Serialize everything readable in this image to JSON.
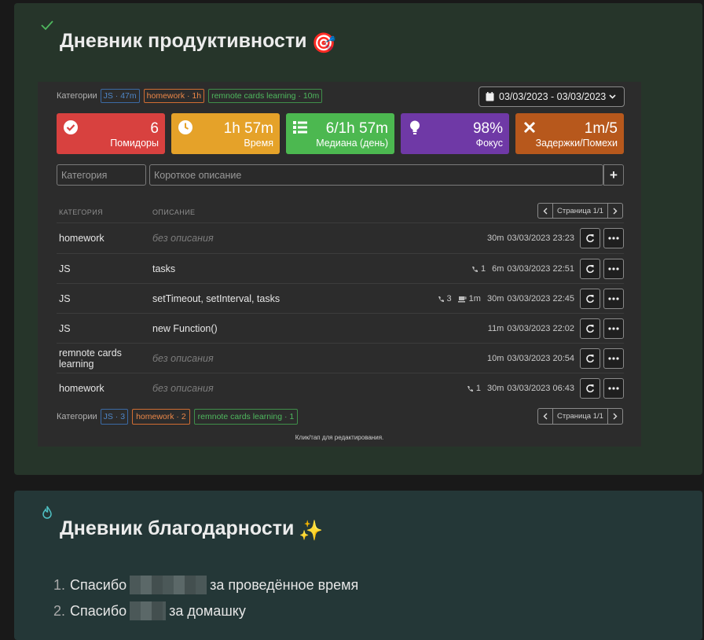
{
  "productivity": {
    "title": "Дневник продуктивности",
    "title_emoji": "🎯",
    "categories_label": "Категории",
    "top_chips": [
      {
        "text": "JS · 47m",
        "color": "blue"
      },
      {
        "text": "homework · 1h",
        "color": "orange"
      },
      {
        "text": "remnote cards learning · 10m",
        "color": "green"
      }
    ],
    "date_range": "03/03/2023 - 03/03/2023",
    "tiles": [
      {
        "value": "6",
        "caption": "Помидоры",
        "icon": "check-circle-icon",
        "color": "#d8413f"
      },
      {
        "value": "1h 57m",
        "caption": "Время",
        "icon": "clock-icon",
        "color": "#e5a229"
      },
      {
        "value": "6/1h 57m",
        "caption": "Медиана (день)",
        "icon": "list-icon",
        "color": "#4cb850"
      },
      {
        "value": "98%",
        "caption": "Фокус",
        "icon": "lightbulb-icon",
        "color": "#6f39a6"
      },
      {
        "value": "1m/5",
        "caption": "Задержки/Помехи",
        "icon": "times-icon",
        "color": "#b7581c"
      }
    ],
    "category_placeholder": "Категория",
    "description_placeholder": "Короткое описание",
    "add_label": "+",
    "col_category": "КАТЕГОРИЯ",
    "col_description": "ОПИСАНИЕ",
    "page_label": "Страница 1/1",
    "rows": [
      {
        "category": "homework",
        "description": "без описания",
        "empty": true,
        "calls": "",
        "breaks": "",
        "duration": "30m",
        "time": "03/03/2023 23:23"
      },
      {
        "category": "JS",
        "description": "tasks",
        "empty": false,
        "calls": "1",
        "breaks": "",
        "duration": "6m",
        "time": "03/03/2023 22:51"
      },
      {
        "category": "JS",
        "description": "setTimeout, setInterval, tasks",
        "empty": false,
        "calls": "3",
        "breaks": "1m",
        "duration": "30m",
        "time": "03/03/2023 22:45"
      },
      {
        "category": "JS",
        "description": "new Function()",
        "empty": false,
        "calls": "",
        "breaks": "",
        "duration": "11m",
        "time": "03/03/2023 22:02"
      },
      {
        "category": "remnote cards learning",
        "description": "без описания",
        "empty": true,
        "calls": "",
        "breaks": "",
        "duration": "10m",
        "time": "03/03/2023 20:54"
      },
      {
        "category": "homework",
        "description": "без описания",
        "empty": true,
        "calls": "1",
        "breaks": "",
        "duration": "30m",
        "time": "03/03/2023 06:43"
      }
    ],
    "bottom_chips": [
      {
        "text": "JS · 3",
        "color": "blue"
      },
      {
        "text": "homework · 2",
        "color": "orange"
      },
      {
        "text": "remnote cards learning · 1",
        "color": "green"
      }
    ],
    "hint": "Клик/тап для редактирования."
  },
  "gratitude": {
    "title": "Дневник благодарности",
    "title_emoji": "✨",
    "items": [
      {
        "num": "1.",
        "prefix": "Спасибо",
        "suffix": "за проведённое время"
      },
      {
        "num": "2.",
        "prefix": "Спасибо",
        "suffix": "за домашку"
      }
    ]
  },
  "colors": {
    "card1_bg": "#26352a",
    "card2_bg": "#243737",
    "widget_bg": "#2c2c2c"
  }
}
